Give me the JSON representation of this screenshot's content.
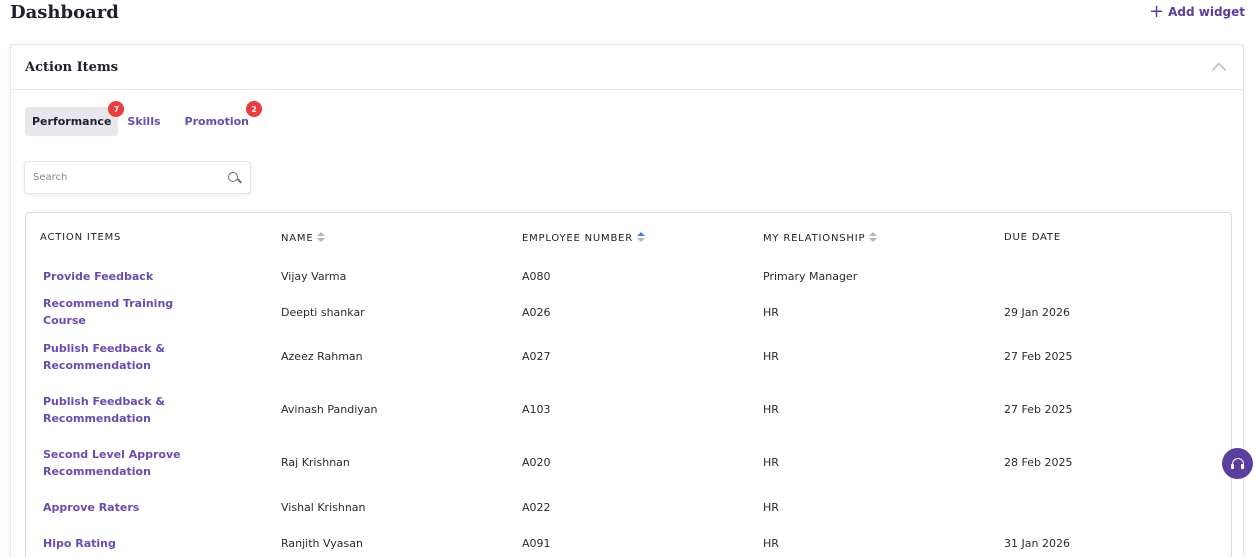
{
  "header": {
    "title": "Dashboard",
    "add_widget_icon": "+",
    "add_widget_label": "Add widget"
  },
  "card": {
    "title": "Action Items",
    "tabs": [
      {
        "label": "Performance",
        "badge": "7",
        "active": true
      },
      {
        "label": "Skills"
      },
      {
        "label": "Promotion",
        "badge": "2"
      }
    ],
    "search": {
      "placeholder": "Search",
      "value": ""
    },
    "table": {
      "columns": [
        "ACTION ITEMS",
        "NAME",
        "EMPLOYEE NUMBER",
        "MY RELATIONSHIP",
        "DUE DATE"
      ],
      "rows": [
        {
          "action": "Provide Feedback",
          "name": "Vijay Varma",
          "emp": "A080",
          "rel": "Primary Manager",
          "due": ""
        },
        {
          "action": "Recommend Training Course",
          "name": "Deepti shankar",
          "emp": "A026",
          "rel": "HR",
          "due": "29 Jan 2026"
        },
        {
          "action": "Publish Feedback & Recommendation",
          "name": "Azeez Rahman",
          "emp": "A027",
          "rel": "HR",
          "due": "27 Feb 2025"
        },
        {
          "action": "Publish Feedback & Recommendation",
          "name": "Avinash Pandiyan",
          "emp": "A103",
          "rel": "HR",
          "due": "27 Feb 2025"
        },
        {
          "action": "Second Level Approve Recommendation",
          "name": "Raj Krishnan",
          "emp": "A020",
          "rel": "HR",
          "due": "28 Feb 2025"
        },
        {
          "action": "Approve Raters",
          "name": "Vishal Krishnan",
          "emp": "A022",
          "rel": "HR",
          "due": ""
        },
        {
          "action": "Hipo Rating",
          "name": "Ranjith Vyasan",
          "emp": "A091",
          "rel": "HR",
          "due": "31 Jan 2026"
        }
      ]
    }
  },
  "colors": {
    "accent": "#6a4bb3",
    "badge": "#ef3b3b",
    "fab": "#5b3f9e"
  }
}
